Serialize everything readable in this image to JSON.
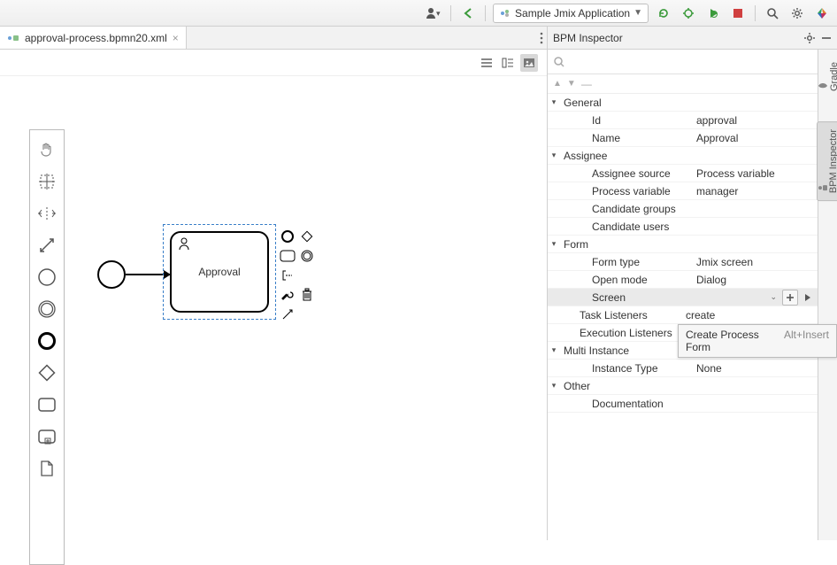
{
  "toolbar": {
    "run_config_label": "Sample Jmix Application"
  },
  "tab": {
    "filename": "approval-process.bpmn20.xml",
    "inspector_title": "BPM Inspector"
  },
  "right_stripe": {
    "gradle": "Gradle",
    "bpm": "BPM Inspector"
  },
  "canvas": {
    "task_label": "Approval"
  },
  "search": {
    "placeholder": ""
  },
  "inspector": {
    "groups": {
      "general": "General",
      "assignee": "Assignee",
      "form": "Form",
      "task_listeners": "Task Listeners",
      "execution_listeners": "Execution Listeners",
      "multi_instance": "Multi Instance",
      "other": "Other"
    },
    "props": {
      "id_k": "Id",
      "id_v": "approval",
      "name_k": "Name",
      "name_v": "Approval",
      "asrc_k": "Assignee source",
      "asrc_v": "Process variable",
      "pvar_k": "Process variable",
      "pvar_v": "manager",
      "cgrp_k": "Candidate groups",
      "cgrp_v": "",
      "cusr_k": "Candidate users",
      "cusr_v": "",
      "ftype_k": "Form type",
      "ftype_v": "Jmix screen",
      "omode_k": "Open mode",
      "omode_v": "Dialog",
      "screen_k": "Screen",
      "screen_v": "",
      "tlist_v": "create",
      "itype_k": "Instance Type",
      "itype_v": "None",
      "doc_k": "Documentation",
      "doc_v": ""
    }
  },
  "tooltip": {
    "label": "Create Process Form",
    "shortcut": "Alt+Insert"
  }
}
